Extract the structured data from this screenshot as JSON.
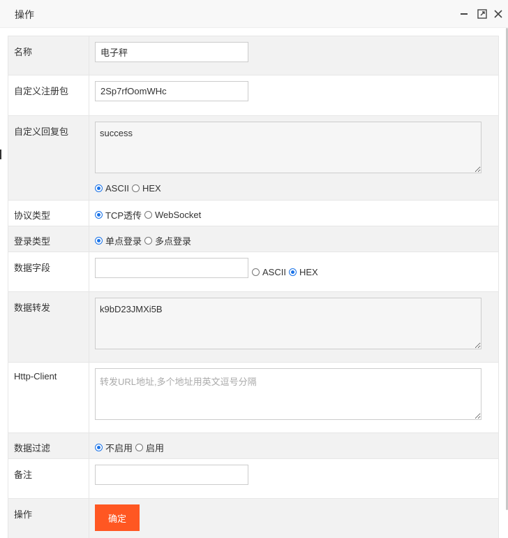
{
  "window": {
    "title": "操作",
    "controls": {
      "minimize_icon": "minimize-icon",
      "maximize_icon": "maximize-icon",
      "close_icon": "close-icon"
    }
  },
  "form": {
    "name": {
      "label": "名称",
      "value": "电子秤"
    },
    "register_packet": {
      "label": "自定义注册包",
      "value": "2Sp7rfOomWHc"
    },
    "reply_packet": {
      "label": "自定义回复包",
      "value": "success",
      "encoding_options": [
        "ASCII",
        "HEX"
      ],
      "encoding_selected": "ASCII"
    },
    "protocol": {
      "label": "协议类型",
      "options": [
        "TCP透传",
        "WebSocket"
      ],
      "selected": "TCP透传"
    },
    "login": {
      "label": "登录类型",
      "options": [
        "单点登录",
        "多点登录"
      ],
      "selected": "单点登录"
    },
    "data_field": {
      "label": "数据字段",
      "value": "",
      "options": [
        "ASCII",
        "HEX"
      ],
      "selected": "HEX"
    },
    "data_forward": {
      "label": "数据转发",
      "value": "k9bD23JMXi5B"
    },
    "http_client": {
      "label": "Http-Client",
      "value": "",
      "placeholder": "转发URL地址,多个地址用英文逗号分隔"
    },
    "data_filter": {
      "label": "数据过滤",
      "options": [
        "不启用",
        "启用"
      ],
      "selected": "不启用"
    },
    "remark": {
      "label": "备注",
      "value": ""
    },
    "action": {
      "label": "操作",
      "submit_label": "确定"
    }
  },
  "colors": {
    "accent": "#ff5722",
    "radio": "#1a73e8",
    "row_shade": "#f2f2f2"
  }
}
